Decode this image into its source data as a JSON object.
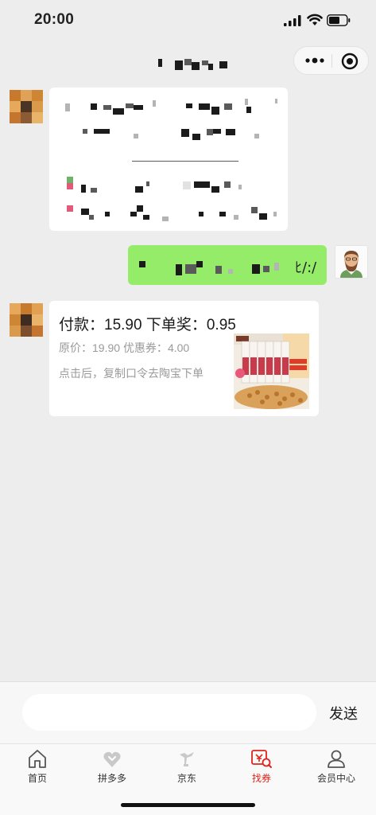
{
  "status_bar": {
    "time": "20:00"
  },
  "capsule": {
    "more_icon": "more-dots-icon",
    "close_icon": "close-circle-icon"
  },
  "chat": {
    "green_bubble_tail": "ﾋ/:/",
    "product_message": {
      "pay_label": "付款：",
      "pay_amount": "15.90",
      "reward_label": "下单奖：",
      "reward_amount": "0.95",
      "original_price_label": "原价：",
      "original_price": "19.90",
      "coupon_label": "优惠券：",
      "coupon_amount": "4.00",
      "hint": "点击后，复制口令去陶宝下单"
    }
  },
  "input_bar": {
    "placeholder": "",
    "send_label": "发送"
  },
  "tabs": [
    {
      "label": "首页",
      "icon": "home-icon"
    },
    {
      "label": "拼多多",
      "icon": "pinduoduo-icon"
    },
    {
      "label": "京东",
      "icon": "jd-icon"
    },
    {
      "label": "找券",
      "icon": "coupon-search-icon",
      "active": true
    },
    {
      "label": "会员中心",
      "icon": "member-icon"
    }
  ],
  "colors": {
    "accent_red": "#e2231a",
    "bubble_green": "#95ec69",
    "background": "#ededed"
  }
}
